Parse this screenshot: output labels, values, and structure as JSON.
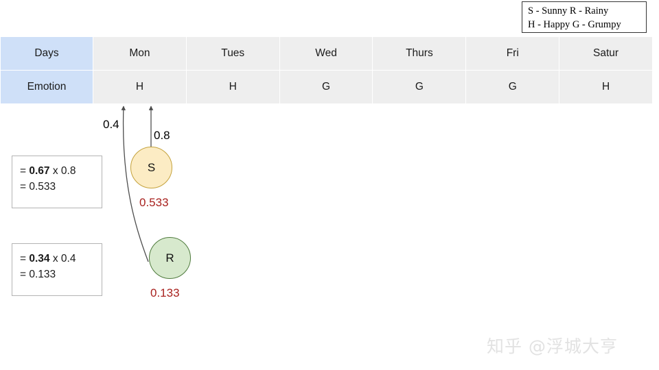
{
  "legend": {
    "line1": "S - Sunny  R - Rainy",
    "line2": "H - Happy G - Grumpy"
  },
  "table": {
    "row_labels": [
      "Days",
      "Emotion"
    ],
    "days": [
      "Mon",
      "Tues",
      "Wed",
      "Thurs",
      "Fri",
      "Satur"
    ],
    "emotions": [
      "H",
      "H",
      "G",
      "G",
      "G",
      "H"
    ],
    "colors": {
      "label_cell_bg": "#cfe0f8",
      "data_cell_bg": "#eeeeee",
      "gridline": "#ffffff"
    }
  },
  "diagram": {
    "edges": [
      {
        "name": "transition-to-rainy",
        "weight": "0.4"
      },
      {
        "name": "transition-to-sunny",
        "weight": "0.8"
      }
    ],
    "nodes": [
      {
        "id": "S",
        "label": "S",
        "meaning": "Sunny",
        "fill": "#fcecc4",
        "stroke": "#c4a23c",
        "value": "0.533"
      },
      {
        "id": "R",
        "label": "R",
        "meaning": "Rainy",
        "fill": "#d7e9cd",
        "stroke": "#4e7a3c",
        "value": "0.133"
      }
    ],
    "value_color": "#a8211e"
  },
  "calculations": [
    {
      "name": "sunny-calc",
      "line1_prefix": "= ",
      "line1_bold": "0.67",
      "line1_suffix": " x 0.8",
      "line2": "= 0.533"
    },
    {
      "name": "rainy-calc",
      "line1_prefix": "= ",
      "line1_bold": "0.34",
      "line1_suffix": " x 0.4",
      "line2": "= 0.133"
    }
  ],
  "watermark": {
    "text": "知乎 @浮城大亨"
  }
}
